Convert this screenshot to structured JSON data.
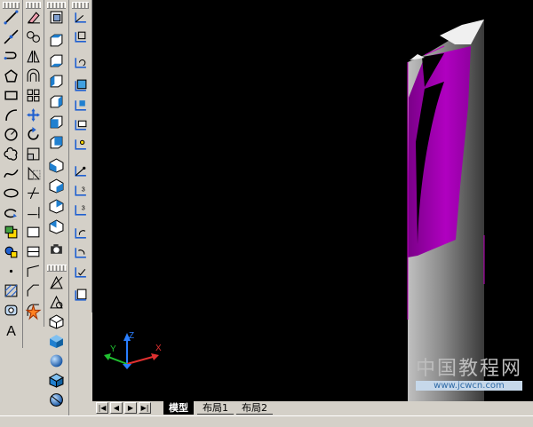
{
  "layout_tabs": {
    "nav": [
      "first-tab",
      "previous-tab",
      "next-tab",
      "last-tab"
    ],
    "tabs": [
      {
        "label": "模型",
        "active": true
      },
      {
        "label": "布局1",
        "active": false
      },
      {
        "label": "布局2",
        "active": false
      }
    ]
  },
  "ucs_icon": {
    "x_label": "X",
    "y_label": "Y",
    "z_label": "Z"
  },
  "watermark": {
    "title": "中国教程网",
    "url": "www.jcwcn.com"
  },
  "toolbars": {
    "draw": [
      "line-icon",
      "construction-line-icon",
      "polyline-icon",
      "polygon-icon",
      "rectangle-icon",
      "arc-icon",
      "circle-icon",
      "revision-cloud-icon",
      "spline-icon",
      "ellipse-icon",
      "ellipse-arc-icon",
      "insert-block-icon",
      "make-block-icon",
      "point-icon",
      "hatch-icon",
      "region-icon",
      "multiline-text-icon"
    ],
    "modify": [
      "erase-icon",
      "copy-icon",
      "mirror-icon",
      "offset-icon",
      "array-icon",
      "move-icon",
      "rotate-icon",
      "scale-icon",
      "stretch-icon",
      "trim-icon",
      "extend-icon",
      "break-at-point-icon",
      "break-icon",
      "join-icon",
      "chamfer-icon",
      "fillet-icon",
      "explode-icon"
    ],
    "view": [
      "named-views-icon",
      "top-view-icon",
      "bottom-view-icon",
      "left-view-icon",
      "right-view-icon",
      "front-view-icon",
      "back-view-icon",
      "sw-iso-icon",
      "se-iso-icon",
      "ne-iso-icon",
      "nw-iso-icon",
      "camera-icon",
      "2d-wireframe-icon",
      "3d-wireframe-icon",
      "hidden-icon",
      "flat-shaded-icon",
      "gouraud-shaded-icon",
      "flat-edges-icon",
      "gouraud-edges-icon"
    ],
    "ucs": [
      "ucs-icon",
      "ucs-world-icon",
      "ucs-previous-icon",
      "ucs-face-icon",
      "ucs-object-icon",
      "ucs-view-icon",
      "ucs-origin-icon",
      "ucs-zaxis-icon",
      "ucs-3point-icon",
      "ucs-x-icon",
      "ucs-y-icon",
      "ucs-z-icon",
      "ucs-apply-icon",
      "named-ucs-icon",
      "ucs-manager-icon"
    ]
  },
  "colors": {
    "canvas": "#000000",
    "magenta_face": "#a000b0",
    "cylinder_light": "#b8b8b8",
    "cylinder_dark": "#3c3c3c",
    "toolbar": "#d4d0c8"
  }
}
